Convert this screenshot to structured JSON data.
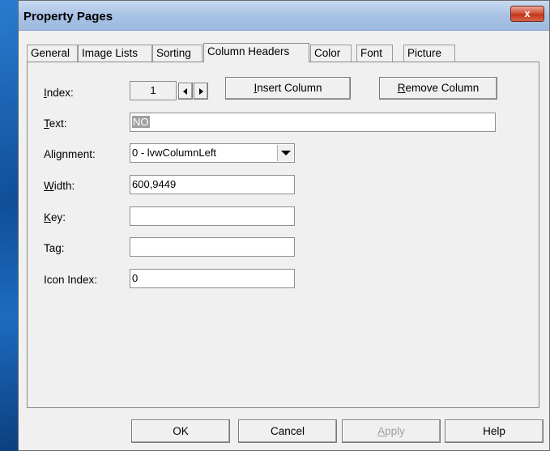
{
  "window": {
    "title": "Property Pages",
    "close_label": "x"
  },
  "tabs": [
    {
      "label": "General"
    },
    {
      "label": "Image Lists"
    },
    {
      "label": "Sorting"
    },
    {
      "label": "Column Headers"
    },
    {
      "label": "Color"
    },
    {
      "label": "Font"
    },
    {
      "label": "Picture"
    }
  ],
  "active_tab": "Column Headers",
  "form": {
    "index": {
      "label_pre": "",
      "label_ul": "I",
      "label_post": "ndex:",
      "value": "1"
    },
    "insert_column": {
      "pre": "",
      "ul": "I",
      "post": "nsert Column"
    },
    "remove_column": {
      "pre": "",
      "ul": "R",
      "post": "emove Column"
    },
    "text": {
      "label_pre": "",
      "label_ul": "T",
      "label_post": "ext:",
      "value": "NO"
    },
    "alignment": {
      "label": "Alignment:",
      "value": "0 - lvwColumnLeft"
    },
    "width": {
      "label_pre": "",
      "label_ul": "W",
      "label_post": "idth:",
      "value": "600,9449"
    },
    "key": {
      "label_pre": "",
      "label_ul": "K",
      "label_post": "ey:",
      "value": ""
    },
    "tag": {
      "label_pre": "Ta",
      "label_ul": "g",
      "label_post": ":",
      "value": ""
    },
    "icon_index": {
      "label": "Icon Index:",
      "value": "0"
    }
  },
  "footer": {
    "ok": "OK",
    "cancel": "Cancel",
    "apply_ul": "A",
    "apply_post": "pply",
    "help": "Help"
  }
}
